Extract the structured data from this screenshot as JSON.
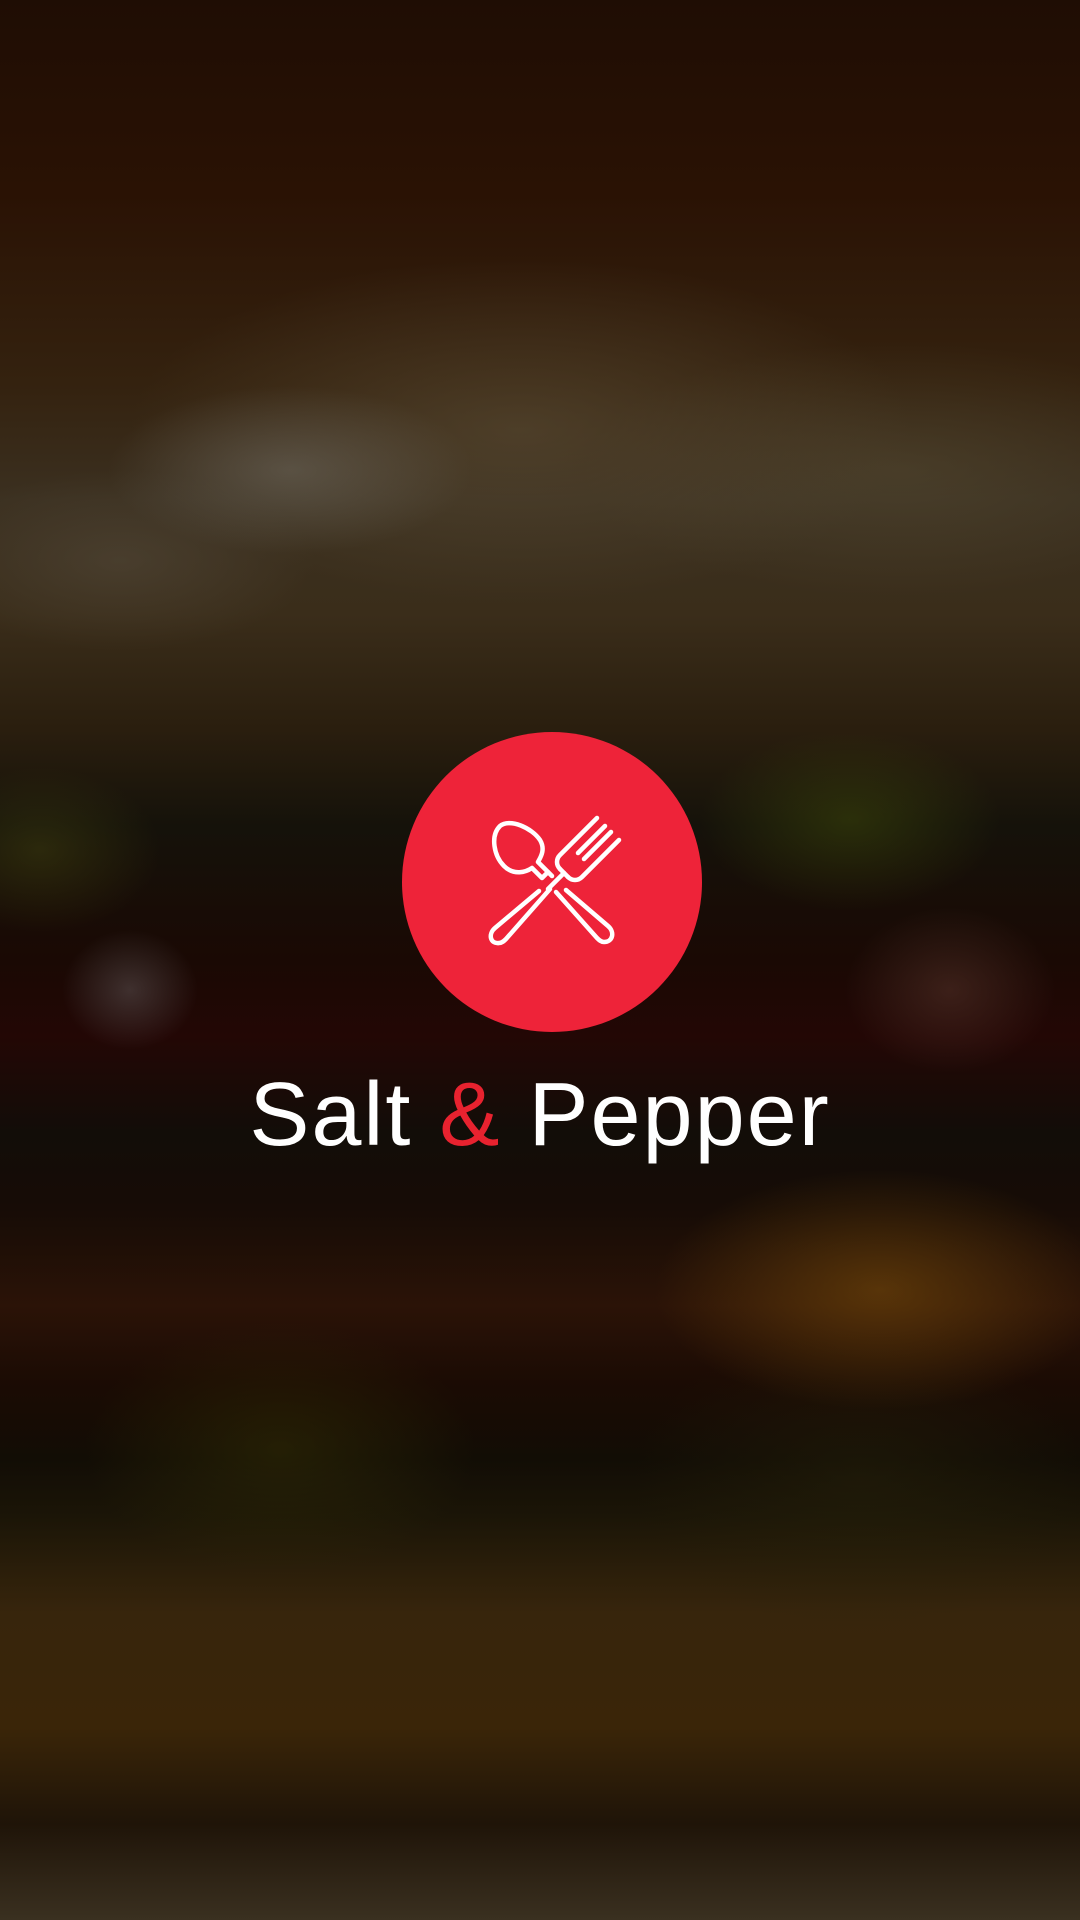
{
  "app": {
    "title_part1": "Salt",
    "title_ampersand": "&",
    "title_part2": "Pepper"
  },
  "logo": {
    "icon": "spoon-and-fork-crossed-icon"
  },
  "colors": {
    "accent": "#ee2339",
    "ampersand": "#e8222f",
    "text": "#ffffff"
  }
}
